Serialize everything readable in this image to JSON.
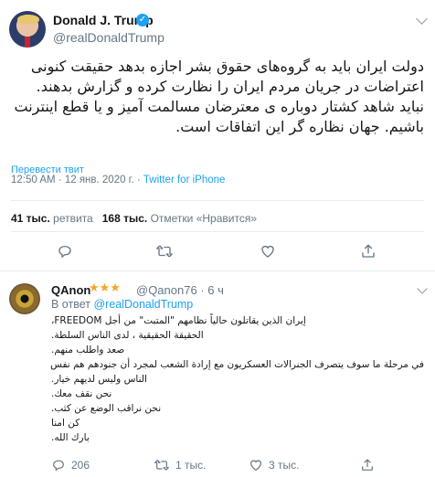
{
  "tweet": {
    "author_name": "Donald J. Trump",
    "handle": "@realDonaldTrump",
    "verified_glyph": "✓",
    "text": "دولت ایران باید به گروه‌های حقوق بشر اجازه بدهد حقیقت کنونی اعتراضات در جریان مردم ایران را نظارت کرده و گزارش بدهند. نباید شاهد کشتار دوباره ی معترضان مسالمت آمیز و یا قطع اینترنت باشیم. جهان نظاره گر این اتفاقات است.",
    "translate_label": "Перевести твит",
    "time": "12:50 AM",
    "date": "12 янв. 2020 г.",
    "separator": "·",
    "source": "Twitter for iPhone",
    "retweets_count": "41 тыс.",
    "retweets_label": "ретвита",
    "likes_count": "168 тыс.",
    "likes_label": "Отметки «Нравится»"
  },
  "reply": {
    "author_name": "QAnon",
    "stars": "★★★",
    "handle": "@Qanon76",
    "separator": "·",
    "age": "6 ч",
    "reply_prefix": "В ответ",
    "reply_mention": "@realDonaldTrump",
    "lines": [
      "إيران الذين يقاتلون حالياً نظامهم \"المتبت\" من أجل FREEDOM،",
      "الحقيقة الحقيقية ، لدى الناس السلطة.",
      "صعد واطلب منهم.",
      "في مرحلة ما سوف يتصرف الجنرالات العسكريون مع إرادة الشعب لمجرد أن جنودهم هم نفس",
      "الناس وليس لديهم خيار.",
      "نحن نقف معك.",
      "نحن نراقب الوضع عن كثب.",
      "كن امنا",
      "بارك الله."
    ],
    "reply_count": "206",
    "retweet_count": "1 тыс.",
    "like_count": "3 тыс."
  },
  "icons": {
    "reply": "reply-icon",
    "retweet": "retweet-icon",
    "like": "heart-icon",
    "share": "share-icon",
    "verified": "verified-badge-icon",
    "menu": "chevron-down-icon"
  },
  "colors": {
    "accent": "#1da1f2",
    "muted": "#657786",
    "text": "#14171a",
    "divider": "#e6ecf0",
    "star": "#f5a623"
  }
}
